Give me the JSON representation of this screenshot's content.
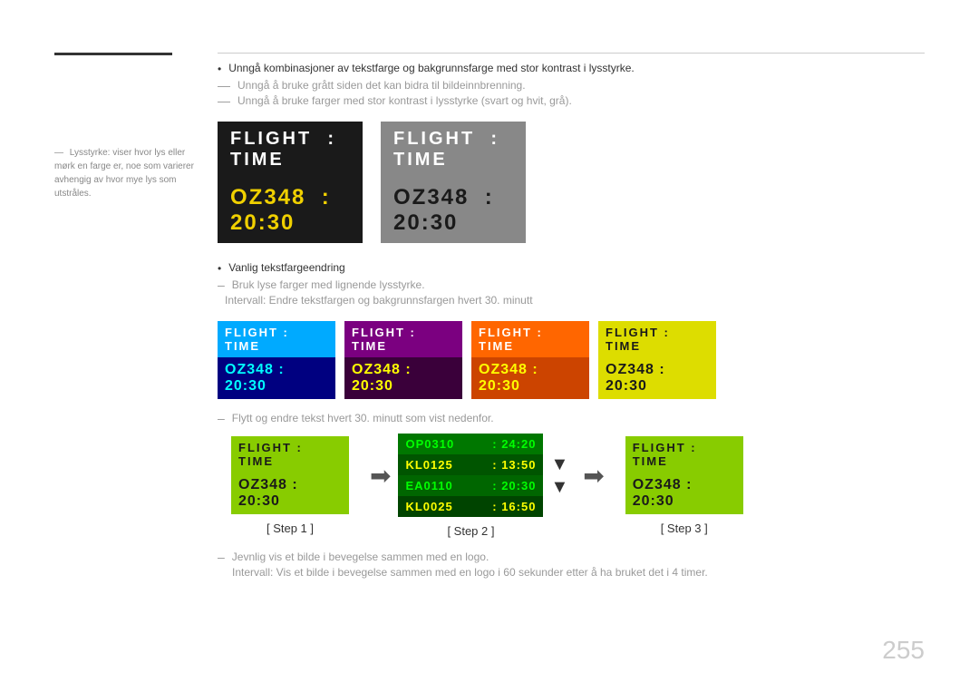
{
  "page": {
    "number": "255"
  },
  "sidebar": {
    "note": "Lysstyrke: viser hvor lys eller mørk en farge er, noe som varierer avhengig av hvor mye lys som utstråles."
  },
  "bullets": {
    "main": "Unngå kombinasjoner av tekstfarge og bakgrunnsfarge med stor kontrast i lysstyrke.",
    "dash1": "Unngå å bruke grått siden det kan bidra til bildeinnbrenning.",
    "dash2": "Unngå å bruke farger med stor kontrast i lysstyrke (svart og hvit, grå)."
  },
  "cards": {
    "flight_label": "FLIGHT",
    "colon": ":",
    "time_label": "TIME",
    "flight_number": "OZ348",
    "time_value": "20:30"
  },
  "small_cards": [
    {
      "theme": "blue",
      "label1": "FLIGHT : TIME",
      "label2": "OZ348 : 20:30"
    },
    {
      "theme": "purple",
      "label1": "FLIGHT : TIME",
      "label2": "OZ348 : 20:30"
    },
    {
      "theme": "orange",
      "label1": "FLIGHT : TIME",
      "label2": "OZ348 : 20:30"
    },
    {
      "theme": "yellow",
      "label1": "FLIGHT : TIME",
      "label2": "OZ348 : 20:30"
    }
  ],
  "dash_note": "Flytt og endre tekst hvert 30. minutt som vist nedenfor.",
  "steps": [
    {
      "label": "[ Step 1 ]"
    },
    {
      "label": "[ Step 2 ]"
    },
    {
      "label": "[ Step 3 ]"
    }
  ],
  "step2_flights": [
    {
      "code": "OP0310",
      "time": "24:20"
    },
    {
      "code": "KL0125",
      "time": "13:50"
    },
    {
      "code": "EA0110",
      "time": "20:30"
    },
    {
      "code": "KL0025",
      "time": "16:50"
    }
  ],
  "bottom_notes": {
    "dash1": "Jevnlig vis et bilde i bevegelse sammen med en logo.",
    "dash2": "Intervall: Vis et bilde i bevegelse sammen med en logo i 60 sekunder etter å ha bruket det i 4 timer."
  },
  "vanlig": {
    "main": "Vanlig tekstfargeendring",
    "dash1": "Bruk lyse farger med lignende lysstyrke.",
    "dash2": "Intervall: Endre tekstfargen og bakgrunnsfargen hvert 30. minutt"
  }
}
